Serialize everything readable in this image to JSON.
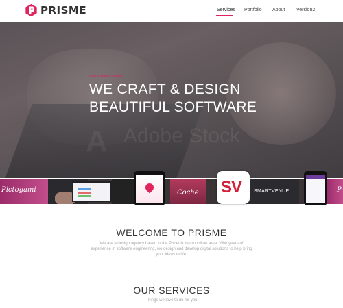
{
  "header": {
    "logo_text": "PRISME",
    "nav": [
      {
        "label": "Services",
        "active": true
      },
      {
        "label": "Portfolio",
        "active": false
      },
      {
        "label": "About",
        "active": false
      },
      {
        "label": "Version2",
        "active": false
      }
    ]
  },
  "hero": {
    "tagline": "Web & Mobile Design",
    "title_line1": "WE CRAFT & DESIGN",
    "title_line2": "BEAUTIFUL SOFTWARE",
    "watermark": "Adobe Stock"
  },
  "strip": {
    "left_brand": "Pictogami",
    "coche": "Coche",
    "sv": "SV",
    "smartvenue": "SMARTVENUE",
    "right_brand": "P"
  },
  "welcome": {
    "title": "WELCOME TO PRISME",
    "text": "We are a design agency based in the Phoenix metropolitan area. With years of experience in software engineering, we design and develop digital solutions to help bring your ideas to life."
  },
  "services": {
    "title": "OUR SERVICES",
    "subtitle": "Things we love to do for you"
  },
  "colors": {
    "accent": "#e0245e",
    "text": "#333333",
    "muted": "#aaaaaa"
  }
}
